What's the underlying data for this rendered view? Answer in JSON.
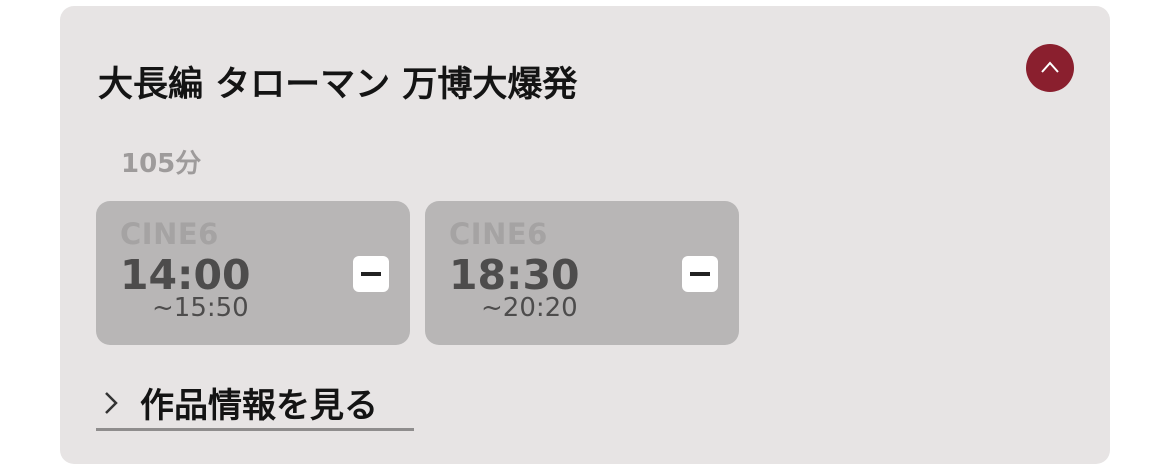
{
  "movie": {
    "title": "大長編 タローマン 万博大爆発",
    "duration": "105分"
  },
  "collapse_icon": "chevron-up-icon",
  "colors": {
    "card_background": "#e7e4e4",
    "accent": "#8a1f2e",
    "showtime_background": "#b8b6b6"
  },
  "showtimes": [
    {
      "screen": "CINE6",
      "start": "14:00",
      "end": "~15:50",
      "icon": "minus-icon"
    },
    {
      "screen": "CINE6",
      "start": "18:30",
      "end": "~20:20",
      "icon": "minus-icon"
    }
  ],
  "details_link": {
    "label": "作品情報を見る",
    "icon": "chevron-right-icon"
  }
}
